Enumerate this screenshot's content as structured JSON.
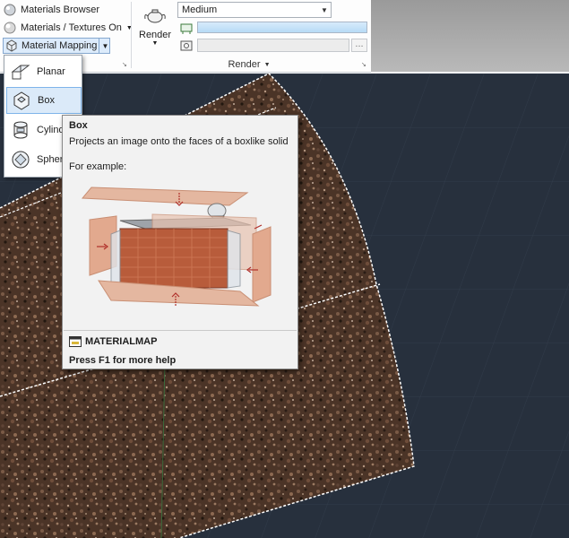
{
  "ribbon": {
    "materials_panel": {
      "materials_browser": "Materials Browser",
      "materials_textures": "Materials / Textures On",
      "material_mapping": "Material Mapping"
    },
    "render_panel": {
      "render_label": "Render",
      "quality_value": "Medium",
      "panel_title": "Render",
      "progress_fraction": 1.0,
      "browse_label": "..."
    }
  },
  "mapping_menu": {
    "items": [
      {
        "label": "Planar",
        "icon": "planar-map-icon"
      },
      {
        "label": "Box",
        "icon": "box-map-icon",
        "selected": true
      },
      {
        "label": "Cylindr",
        "icon": "cylindrical-map-icon"
      },
      {
        "label": "Spheric",
        "icon": "spherical-map-icon"
      }
    ]
  },
  "tooltip": {
    "title": "Box",
    "description": "Projects an image onto the faces of a boxlike solid",
    "example_label": "For example:",
    "command": "MATERIALMAP",
    "help": "Press F1 for more help"
  },
  "colors": {
    "viewport_bg": "#27303d",
    "texture_base": "#4a3226",
    "ribbon_bg": "#f5f6f7",
    "selection": "#dbeaf9",
    "tooltip_bg": "#f2f2f2"
  }
}
